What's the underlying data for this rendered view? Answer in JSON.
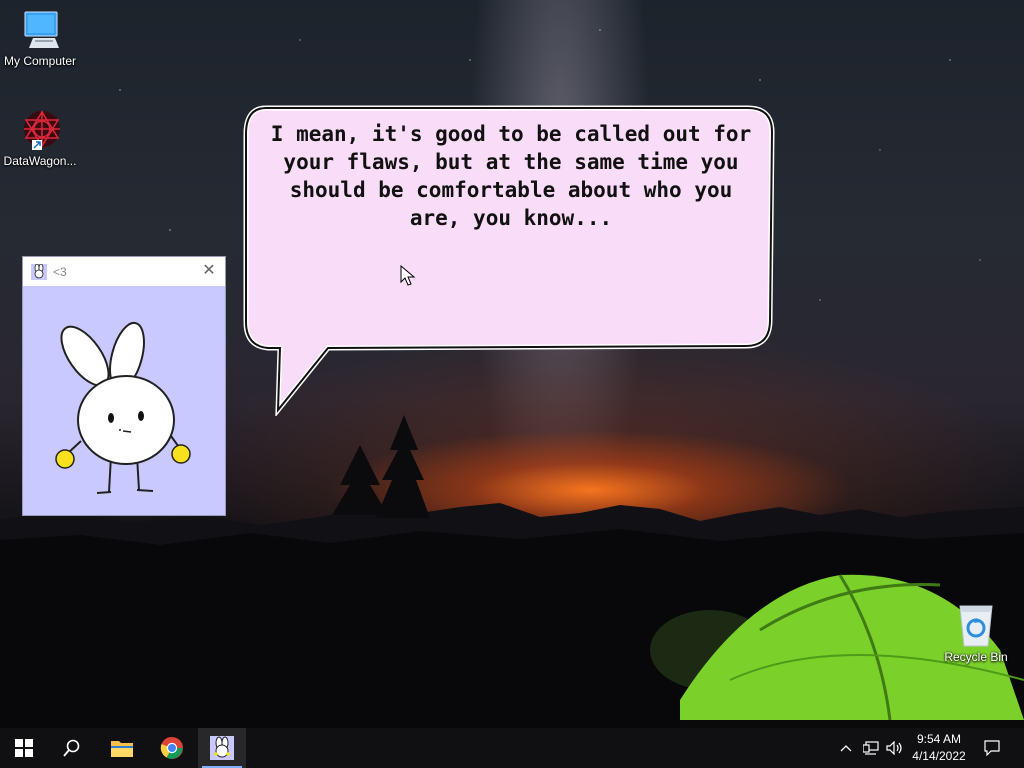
{
  "desktop": {
    "icons": [
      {
        "label": "My Computer",
        "icon": "monitor-icon"
      },
      {
        "label": "DataWagon...",
        "icon": "datawagon-icon"
      },
      {
        "label": "Recycle Bin",
        "icon": "recycle-bin-icon"
      }
    ]
  },
  "speech_bubble": {
    "text": "I mean, it's good to be called out for your flaws, but at the same time you should be comfortable about who you are, you know..."
  },
  "pet_window": {
    "title": "<3",
    "close_icon": "close-icon",
    "background_color": "#c9c9ff"
  },
  "taskbar": {
    "start_icon": "windows-start-icon",
    "search_icon": "search-icon",
    "pinned": [
      {
        "name": "File Explorer",
        "icon": "folder-icon"
      },
      {
        "name": "Google Chrome",
        "icon": "chrome-icon"
      },
      {
        "name": "<3",
        "icon": "bunny-app-icon",
        "active": true
      }
    ],
    "tray": {
      "icons": [
        "chevron-up-icon",
        "network-icon",
        "volume-icon"
      ],
      "time": "9:54 AM",
      "date": "4/14/2022",
      "notification_icon": "notification-icon"
    }
  }
}
